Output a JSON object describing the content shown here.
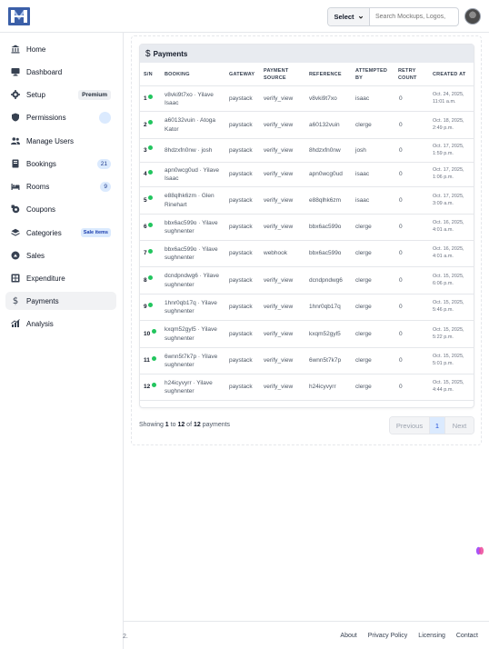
{
  "header": {
    "select_label": "Select",
    "search_placeholder": "Search Mockups, Logos,"
  },
  "sidebar": {
    "items": [
      {
        "label": "Home",
        "icon": "bank-icon"
      },
      {
        "label": "Dashboard",
        "icon": "monitor-icon"
      },
      {
        "label": "Setup",
        "icon": "gear-icon",
        "badge": "Premium"
      },
      {
        "label": "Permissions",
        "icon": "shield-icon"
      },
      {
        "label": "Manage Users",
        "icon": "users-icon"
      },
      {
        "label": "Bookings",
        "icon": "book-icon",
        "badge": "21"
      },
      {
        "label": "Rooms",
        "icon": "bed-icon",
        "badge": "9"
      },
      {
        "label": "Coupons",
        "icon": "coupon-icon"
      },
      {
        "label": "Categories",
        "icon": "layers-icon",
        "badge": "Sale items"
      },
      {
        "label": "Sales",
        "icon": "sales-icon"
      },
      {
        "label": "Expenditure",
        "icon": "grid-icon"
      },
      {
        "label": "Payments",
        "icon": "dollar-icon"
      },
      {
        "label": "Analysis",
        "icon": "analysis-icon"
      }
    ]
  },
  "payments": {
    "title": "Payments",
    "columns": [
      "S/N",
      "BOOKING",
      "GATEWAY",
      "PAYMENT SOURCE",
      "REFERENCE",
      "ATTEMPTED BY",
      "RETRY COUNT",
      "CREATED AT"
    ],
    "rows": [
      {
        "sn": "1",
        "booking_code": "v8vki9t7xo",
        "booking_user": "Yilave Isaac",
        "gateway": "paystack",
        "source": "verify_view",
        "reference": "v8vki9t7xo",
        "attempted_by": "isaac",
        "retry": "0",
        "created_at": "Oct. 24, 2025, 11:01 a.m."
      },
      {
        "sn": "2",
        "booking_code": "a60132vuin",
        "booking_user": "Atoga Kator",
        "gateway": "paystack",
        "source": "verify_view",
        "reference": "a60132vuin",
        "attempted_by": "clerge",
        "retry": "0",
        "created_at": "Oct. 18, 2025, 2:49 p.m."
      },
      {
        "sn": "3",
        "booking_code": "8hdzxfn0nw",
        "booking_user": "josh",
        "gateway": "paystack",
        "source": "verify_view",
        "reference": "8hdzxfn0nw",
        "attempted_by": "josh",
        "retry": "0",
        "created_at": "Oct. 17, 2025, 1:59 p.m."
      },
      {
        "sn": "4",
        "booking_code": "apn0wcg0ud",
        "booking_user": "Yilave Isaac",
        "gateway": "paystack",
        "source": "verify_view",
        "reference": "apn0wcg0ud",
        "attempted_by": "isaac",
        "retry": "0",
        "created_at": "Oct. 17, 2025, 1:06 p.m."
      },
      {
        "sn": "5",
        "booking_code": "e88qlhk6zm",
        "booking_user": "Glen Rinehart",
        "gateway": "paystack",
        "source": "verify_view",
        "reference": "e88qlhk6zm",
        "attempted_by": "isaac",
        "retry": "0",
        "created_at": "Oct. 17, 2025, 3:09 a.m."
      },
      {
        "sn": "6",
        "booking_code": "bbx6ac599o",
        "booking_user": "Yilave sughnenter",
        "gateway": "paystack",
        "source": "verify_view",
        "reference": "bbx6ac599o",
        "attempted_by": "clerge",
        "retry": "0",
        "created_at": "Oct. 16, 2025, 4:01 a.m."
      },
      {
        "sn": "7",
        "booking_code": "bbx6ac599o",
        "booking_user": "Yilave sughnenter",
        "gateway": "paystack",
        "source": "webhook",
        "reference": "bbx6ac599o",
        "attempted_by": "clerge",
        "retry": "0",
        "created_at": "Oct. 16, 2025, 4:01 a.m."
      },
      {
        "sn": "8",
        "booking_code": "dcndpndwg6",
        "booking_user": "Yilave sughnenter",
        "gateway": "paystack",
        "source": "verify_view",
        "reference": "dcndpndwg6",
        "attempted_by": "clerge",
        "retry": "0",
        "created_at": "Oct. 15, 2025, 6:06 p.m."
      },
      {
        "sn": "9",
        "booking_code": "1hnr0qb17q",
        "booking_user": "Yilave sughnenter",
        "gateway": "paystack",
        "source": "verify_view",
        "reference": "1hnr0qb17q",
        "attempted_by": "clerge",
        "retry": "0",
        "created_at": "Oct. 15, 2025, 5:46 p.m."
      },
      {
        "sn": "10",
        "booking_code": "kxqm52gyl5",
        "booking_user": "Yilave sughnenter",
        "gateway": "paystack",
        "source": "verify_view",
        "reference": "kxqm52gyl5",
        "attempted_by": "clerge",
        "retry": "0",
        "created_at": "Oct. 15, 2025, 5:22 p.m."
      },
      {
        "sn": "11",
        "booking_code": "6wnn5t7k7p",
        "booking_user": "Yilave sughnenter",
        "gateway": "paystack",
        "source": "verify_view",
        "reference": "6wnn5t7k7p",
        "attempted_by": "clerge",
        "retry": "0",
        "created_at": "Oct. 15, 2025, 5:01 p.m."
      },
      {
        "sn": "12",
        "booking_code": "h24icyvyrr",
        "booking_user": "Yilave sughnenter",
        "gateway": "paystack",
        "source": "verify_view",
        "reference": "h24icyvyrr",
        "attempted_by": "clerge",
        "retry": "0",
        "created_at": "Oct. 15, 2025, 4:44 p.m."
      }
    ],
    "summary": {
      "prefix": "Showing ",
      "from": "1",
      "to_word": " to ",
      "to": "12",
      "of_word": " of ",
      "total": "12",
      "suffix": " payments"
    },
    "pager": {
      "prev": "Previous",
      "page": "1",
      "next": "Next"
    }
  },
  "footer": {
    "left": "2.",
    "links": [
      "About",
      "Privacy Policy",
      "Licensing",
      "Contact"
    ]
  },
  "colors": {
    "status_dot": "#22c55e",
    "badge_blue": "#dbeafe",
    "header_bg": "#e8ebf0"
  }
}
